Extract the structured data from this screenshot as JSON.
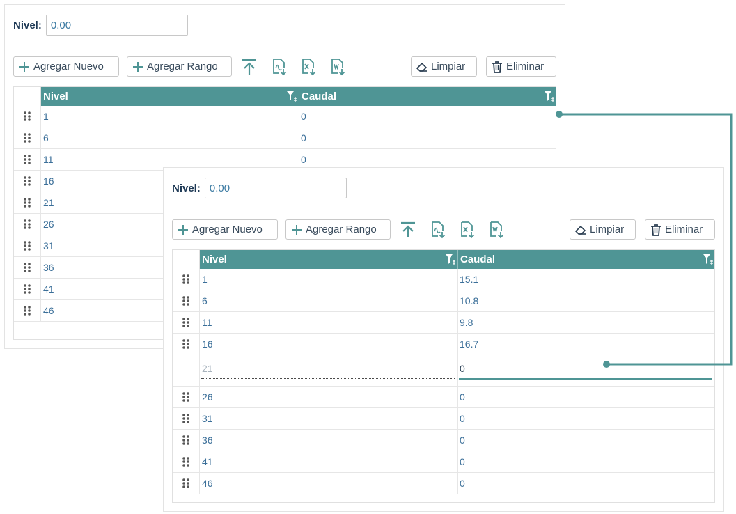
{
  "panels": {
    "back": {
      "nivel_label": "Nivel:",
      "nivel_value": "0.00",
      "toolbar": {
        "agregar_nuevo": "Agregar Nuevo",
        "agregar_rango": "Agregar Rango",
        "limpiar": "Limpiar",
        "eliminar": "Eliminar"
      },
      "columns": [
        "Nivel",
        "Caudal"
      ],
      "rows": [
        {
          "nivel": "1",
          "caudal": "0"
        },
        {
          "nivel": "6",
          "caudal": "0"
        },
        {
          "nivel": "11",
          "caudal": "0"
        },
        {
          "nivel": "16",
          "caudal": ""
        },
        {
          "nivel": "21",
          "caudal": ""
        },
        {
          "nivel": "26",
          "caudal": ""
        },
        {
          "nivel": "31",
          "caudal": ""
        },
        {
          "nivel": "36",
          "caudal": ""
        },
        {
          "nivel": "41",
          "caudal": ""
        },
        {
          "nivel": "46",
          "caudal": ""
        }
      ]
    },
    "front": {
      "nivel_label": "Nivel:",
      "nivel_value": "0.00",
      "toolbar": {
        "agregar_nuevo": "Agregar Nuevo",
        "agregar_rango": "Agregar Rango",
        "limpiar": "Limpiar",
        "eliminar": "Eliminar"
      },
      "columns": [
        "Nivel",
        "Caudal"
      ],
      "rows": [
        {
          "nivel": "1",
          "caudal": "15.1"
        },
        {
          "nivel": "6",
          "caudal": "10.8"
        },
        {
          "nivel": "11",
          "caudal": "9.8"
        },
        {
          "nivel": "16",
          "caudal": "16.7"
        },
        {
          "nivel": "21",
          "caudal": "0",
          "editing": true
        },
        {
          "nivel": "26",
          "caudal": "0"
        },
        {
          "nivel": "31",
          "caudal": "0"
        },
        {
          "nivel": "36",
          "caudal": "0"
        },
        {
          "nivel": "41",
          "caudal": "0"
        },
        {
          "nivel": "46",
          "caudal": "0"
        }
      ]
    }
  },
  "colors": {
    "header_bg": "#4f9595",
    "accent": "#4f9595",
    "text_value": "#3b6f99",
    "label": "#1f3a56"
  },
  "icons": {
    "add": "plus-icon",
    "upload": "upload-icon",
    "pdf": "pdf-export-icon",
    "excel": "excel-export-icon",
    "word": "word-export-icon",
    "limpiar": "eraser-icon",
    "eliminar": "trash-icon",
    "filter": "filter-icon",
    "drag": "drag-handle-icon"
  }
}
